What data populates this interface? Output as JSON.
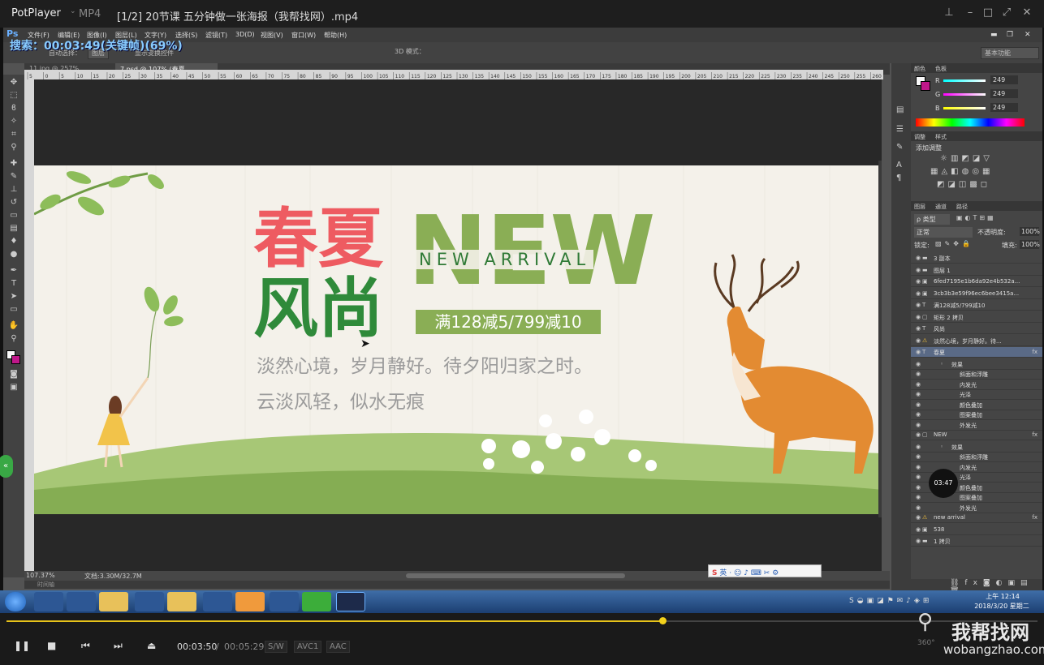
{
  "player": {
    "app_name": "PotPlayer",
    "format": "MP4",
    "file_title": "[1/2] 20节课 五分钟做一张海报（我帮找网）.mp4",
    "osd": "搜索：00:03:49(关键帧)(69%)",
    "time_current": "00:03:50",
    "time_sep": "/",
    "time_total": "00:05:29",
    "tag_sw": "S/W",
    "tag_video": "AVC1",
    "tag_audio": "AAC",
    "progress_fraction": 0.636,
    "watermark": "我帮找网",
    "watermark_url": "wobangzhao.com",
    "small_timer": "03:47",
    "corner_text": "360°"
  },
  "photoshop": {
    "logo": "Ps",
    "menu": [
      "文件(F)",
      "编辑(E)",
      "图像(I)",
      "图层(L)",
      "文字(Y)",
      "选择(S)",
      "滤镜(T)",
      "3D(D)",
      "视图(V)",
      "窗口(W)",
      "帮助(H)"
    ],
    "options": {
      "auto_select": "自动选择：",
      "layer_opt": "图层",
      "transform": "显示变换控件",
      "mode3d": "3D 模式：",
      "workspace": "基本功能"
    },
    "tabs": [
      "11.jpg @ 257%(RGB/8#)",
      "7.psd @ 107% (春夏, RGB/8#)"
    ],
    "ruler_h": [
      "5",
      "0",
      "5",
      "10",
      "15",
      "20",
      "25",
      "30",
      "35",
      "40",
      "45",
      "50",
      "55",
      "60",
      "65",
      "70",
      "75",
      "80",
      "85",
      "90",
      "95",
      "100",
      "105",
      "110",
      "115",
      "120",
      "125",
      "130",
      "135",
      "140",
      "145",
      "150",
      "155",
      "160",
      "165",
      "170",
      "175",
      "180",
      "185",
      "190",
      "195",
      "200",
      "205",
      "210",
      "215",
      "220",
      "225",
      "230",
      "235",
      "240",
      "245",
      "250",
      "255",
      "260"
    ],
    "status": {
      "zoom": "107.37%",
      "doc": "文档:3.30M/32.7M"
    },
    "timeline_label": "时间轴",
    "color_panel": {
      "tab1": "颜色",
      "tab2": "色板",
      "r_label": "R",
      "g_label": "G",
      "b_label": "B",
      "r": "249",
      "g": "249",
      "b": "249"
    },
    "adjust_panel": {
      "tab1": "调整",
      "tab2": "样式",
      "title": "添加调整"
    },
    "layers_panel": {
      "tabs": [
        "图层",
        "通道",
        "路径"
      ],
      "kind": "ρ 类型",
      "blend": "正常",
      "opacity_label": "不透明度:",
      "opacity": "100%",
      "lock_label": "锁定:",
      "fill_label": "填充:",
      "fill": "100%",
      "layers": [
        {
          "name": "3 副本",
          "type": "img",
          "fx": ""
        },
        {
          "name": "图层 1",
          "type": "img",
          "fx": ""
        },
        {
          "name": "6fed7195e1b6da92e4b532a...",
          "type": "smart",
          "fx": ""
        },
        {
          "name": "3cb3b3e59f96ec6bee3415a...",
          "type": "smart",
          "fx": ""
        },
        {
          "name": "满128减5/799减10",
          "type": "text",
          "fx": ""
        },
        {
          "name": "矩形 2 拷贝",
          "type": "shape",
          "fx": ""
        },
        {
          "name": "风尚",
          "type": "text",
          "fx": ""
        },
        {
          "name": "淡然心境，岁月静好。待...",
          "type": "warn",
          "fx": ""
        },
        {
          "name": "春夏",
          "type": "text",
          "fx": "fx"
        },
        {
          "name": "效果",
          "type": "sub",
          "fx": ""
        },
        {
          "name": "斜面和浮雕",
          "type": "sub2",
          "fx": ""
        },
        {
          "name": "内发光",
          "type": "sub2",
          "fx": ""
        },
        {
          "name": "光泽",
          "type": "sub2",
          "fx": ""
        },
        {
          "name": "颜色叠加",
          "type": "sub2",
          "fx": ""
        },
        {
          "name": "图案叠加",
          "type": "sub2",
          "fx": ""
        },
        {
          "name": "外发光",
          "type": "sub2",
          "fx": ""
        },
        {
          "name": "NEW",
          "type": "shape",
          "fx": "fx"
        },
        {
          "name": "效果",
          "type": "sub",
          "fx": ""
        },
        {
          "name": "斜面和浮雕",
          "type": "sub2",
          "fx": ""
        },
        {
          "name": "内发光",
          "type": "sub2",
          "fx": ""
        },
        {
          "name": "光泽",
          "type": "sub2",
          "fx": ""
        },
        {
          "name": "颜色叠加",
          "type": "sub2",
          "fx": ""
        },
        {
          "name": "图案叠加",
          "type": "sub2",
          "fx": ""
        },
        {
          "name": "外发光",
          "type": "sub2",
          "fx": ""
        },
        {
          "name": "new arrival",
          "type": "warn",
          "fx": "fx"
        },
        {
          "name": "538",
          "type": "smart",
          "fx": ""
        },
        {
          "name": "1 拷贝",
          "type": "img",
          "fx": ""
        }
      ]
    },
    "ime_bar": "英"
  },
  "poster": {
    "title_red": "春夏",
    "title_green": "风尚",
    "big_new": "NEW",
    "arrival": "NEW ARRIVAL",
    "promo": "满128减5/799减10",
    "line1": "淡然心境，岁月静好。待夕阳归家之时。",
    "line2": "云淡风轻，似水无痕",
    "colors": {
      "red": "#ee5b61",
      "green": "#2f8a3a",
      "new_green": "#8aae55",
      "bg": "#f4f1ea"
    }
  },
  "taskbar": {
    "time": "上午 12:14",
    "date": "2018/3/20 星期二"
  }
}
